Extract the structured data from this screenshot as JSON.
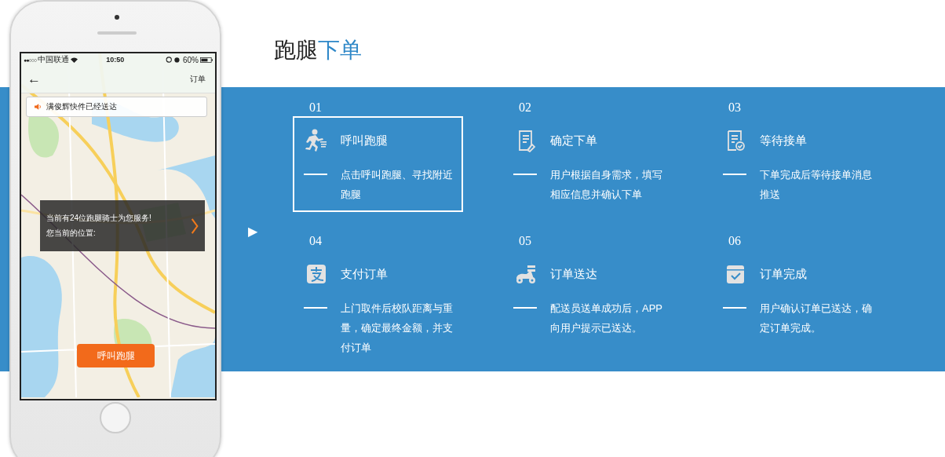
{
  "title": {
    "lead": "跑腿",
    "accent": "下单"
  },
  "phone": {
    "status_bar": {
      "signal": "●●○○○",
      "carrier": "中国联通",
      "time": "10:50",
      "battery": "60%"
    },
    "nav": {
      "back": "←",
      "title": "订单"
    },
    "notice": "满俊辉快件已经送达",
    "overlay": {
      "lines": [
        "当前有24位跑腿骑士为您服务!",
        "您当前的位置:"
      ]
    },
    "call_button": "呼叫跑腿"
  },
  "play_marker": "▶",
  "steps": [
    {
      "number": "01",
      "kind": "runner",
      "title": "呼叫跑腿",
      "description": "点击呼叫跑腿、寻找附近跑腿",
      "selected": true
    },
    {
      "number": "02",
      "kind": "document",
      "title": "确定下单",
      "description": "用户根据自身需求，填写相应信息并确认下单",
      "selected": false
    },
    {
      "number": "03",
      "kind": "checklist",
      "title": "等待接单",
      "description": "下单完成后等待接单消息推送",
      "selected": false
    },
    {
      "number": "04",
      "kind": "pay",
      "title": "支付订单",
      "description": "上门取件后校队距离与重量，确定最终金额，并支付订单",
      "selected": false
    },
    {
      "number": "05",
      "kind": "scooter",
      "title": "订单送达",
      "description": "配送员送单成功后，APP向用户提示已送达。",
      "selected": false
    },
    {
      "number": "06",
      "kind": "done",
      "title": "订单完成",
      "description": "用户确认订单已送达，确定订单完成。",
      "selected": false
    }
  ]
}
